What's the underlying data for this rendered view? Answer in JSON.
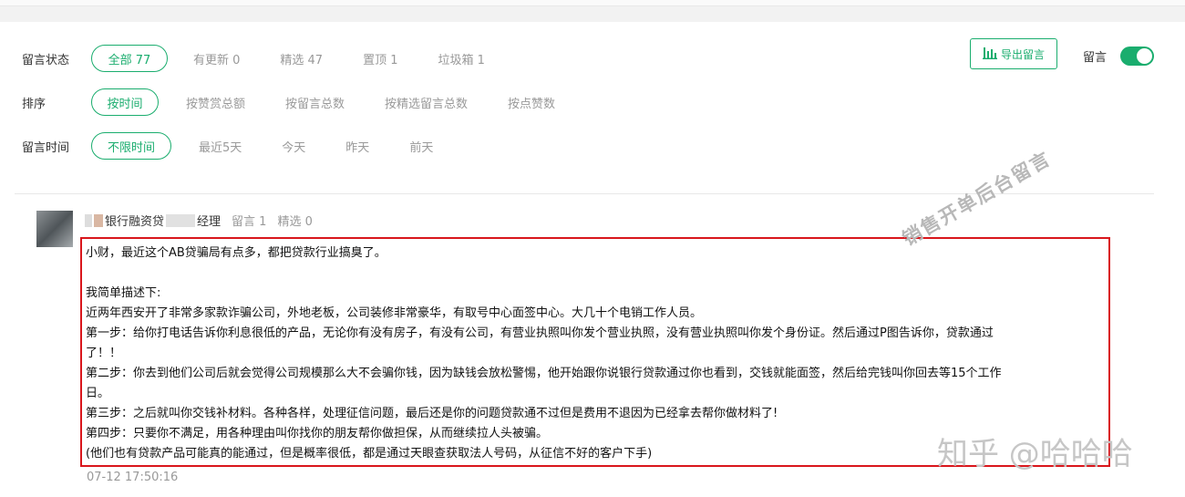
{
  "filters": {
    "status": {
      "label": "留言状态",
      "active": "全部 77",
      "options": [
        "有更新 0",
        "精选 47",
        "置顶 1",
        "垃圾箱 1"
      ]
    },
    "sort": {
      "label": "排序",
      "active": "按时间",
      "options": [
        "按赞赏总额",
        "按留言总数",
        "按精选留言总数",
        "按点赞数"
      ]
    },
    "time": {
      "label": "留言时间",
      "active": "不限时间",
      "options": [
        "最近5天",
        "今天",
        "昨天",
        "前天"
      ]
    }
  },
  "toolbar": {
    "export_label": "导出留言",
    "toggle_label": "留言",
    "toggle_on": true
  },
  "comment": {
    "author_visible": "银行融资贷",
    "author_suffix": "经理",
    "count_label": "留言 1",
    "featured_label": "精选 0",
    "lines": [
      "小财，最近这个AB贷骗局有点多，都把贷款行业搞臭了。",
      "",
      "我简单描述下:",
      "近两年西安开了非常多家款诈骗公司，外地老板，公司装修非常豪华，有取号中心面签中心。大几十个电销工作人员。",
      "第一步：给你打电话告诉你利息很低的产品，无论你有没有房子，有没有公司，有营业执照叫你发个营业执照，没有营业执照叫你发个身份证。然后通过P图告诉你，贷款通过",
      "了！！",
      "第二步：你去到他们公司后就会觉得公司规模那么大不会骗你钱，因为缺钱会放松警惕，他开始跟你说银行贷款通过你也看到，交钱就能面签，然后给完钱叫你回去等15个工作",
      "日。",
      "第三步：之后就叫你交钱补材料。各种各样，处理征信问题，最后还是你的问题贷款通不过但是费用不退因为已经拿去帮你做材料了!",
      "第四步：只要你不满足，用各种理由叫你找你的朋友帮你做担保，从而继续拉人头被骗。",
      "(他们也有贷款产品可能真的能通过，但是概率很低，都是通过天眼查获取法人号码，从征信不好的客户下手)"
    ],
    "timestamp": "07-12 17:50:16"
  },
  "watermarks": {
    "diagonal": "销售开单后台留言",
    "zhihu": "知乎 @哈哈哈"
  },
  "colors": {
    "accent": "#1aad6e",
    "highlight_border": "#d9161c"
  }
}
